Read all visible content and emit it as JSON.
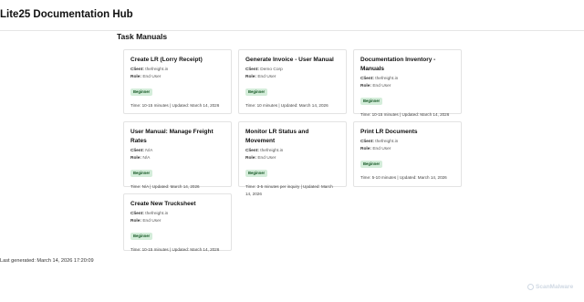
{
  "header": {
    "title": "Lite25 Documentation Hub"
  },
  "section": {
    "title": "Task Manuals"
  },
  "labels": {
    "client": "Client:",
    "role": "Role:"
  },
  "manuals": [
    {
      "title": "Create LR (Lorry Receipt)",
      "client": "thefreight.in",
      "role": "End User",
      "level": "Beginner",
      "footer": "Time: 10-15 minutes | Updated: March 14, 2026"
    },
    {
      "title": "Generate Invoice - User Manual",
      "client": "Demo Corp",
      "role": "End User",
      "level": "Beginner",
      "footer": "Time: 10 minutes | Updated: March 14, 2026"
    },
    {
      "title": "Documentation Inventory - Manuals",
      "client": "thefreight.in",
      "role": "End User",
      "level": "Beginner",
      "footer": "Time: 10-15 minutes | Updated: March 14, 2026"
    },
    {
      "title": "User Manual: Manage Freight Rates",
      "client": "N/A",
      "role": "N/A",
      "level": "Beginner",
      "footer": "Time: N/A | Updated: March 14, 2026"
    },
    {
      "title": "Monitor LR Status and Movement",
      "client": "thefreight.in",
      "role": "End User",
      "level": "Beginner",
      "footer": "Time: 3-5 minutes per inquiry | Updated: March 14, 2026"
    },
    {
      "title": "Print LR Documents",
      "client": "thefreight.in",
      "role": "End User",
      "level": "Beginner",
      "footer": "Time: 5-10 minutes | Updated: March 14, 2026"
    },
    {
      "title": "Create New Trucksheet",
      "client": "thefreight.in",
      "role": "End User",
      "level": "Beginner",
      "footer": "Time: 10-15 minutes | Updated: March 14, 2026"
    }
  ],
  "footer": {
    "generated": "Last generated: March 14, 2026 17:20:09"
  },
  "watermark": {
    "text": "ScanMalware"
  },
  "colors": {
    "badge_bg": "#d4edda",
    "badge_text": "#155724"
  }
}
